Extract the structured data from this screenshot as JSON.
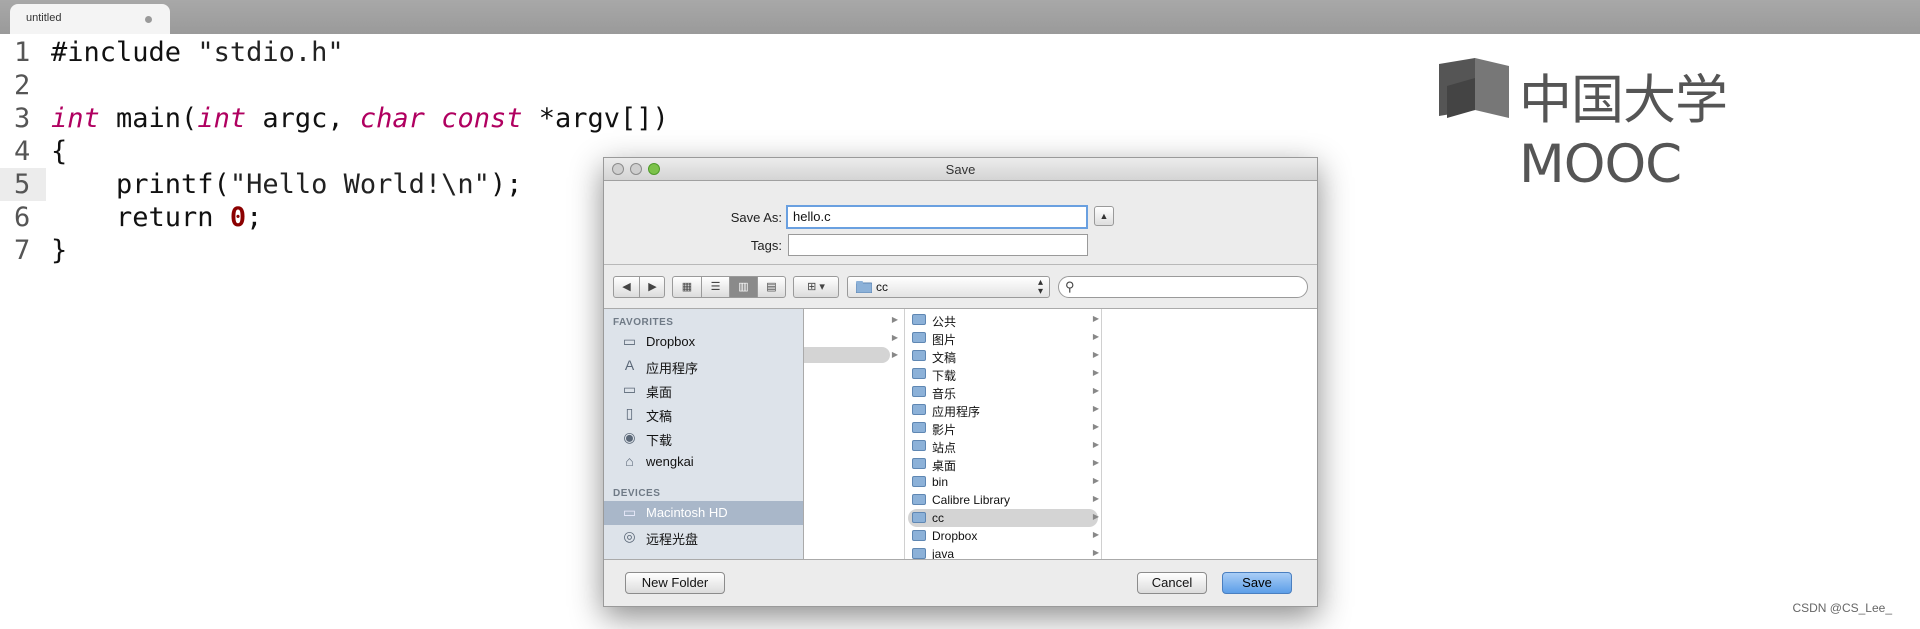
{
  "editor": {
    "tab_title": "untitled",
    "lines": [
      {
        "num": "1"
      },
      {
        "num": "2"
      },
      {
        "num": "3"
      },
      {
        "num": "4"
      },
      {
        "num": "5"
      },
      {
        "num": "6"
      },
      {
        "num": "7"
      }
    ],
    "code": {
      "l1_directive": "#include ",
      "l1_header": "\"stdio.h\"",
      "l3_int1": "int",
      "l3_main": " main(",
      "l3_int2": "int",
      "l3_argc": " argc, ",
      "l3_char": "char",
      "l3_sp": " ",
      "l3_const": "const",
      "l3_argv": " *argv[])",
      "l4": "{",
      "l5_printf": "    printf(",
      "l5_str": "\"Hello World!\\n\"",
      "l5_end": ");",
      "l6_return": "    return ",
      "l6_zero": "0",
      "l6_semi": ";",
      "l7": "}"
    }
  },
  "logo": {
    "text": "中国大学MOOC"
  },
  "dialog": {
    "title": "Save",
    "save_as_label": "Save As:",
    "save_as_value": "hello.c",
    "tags_label": "Tags:",
    "tags_value": "",
    "location": "cc",
    "sidebar": {
      "favorites_header": "FAVORITES",
      "favorites": [
        {
          "label": "Dropbox",
          "icon": "folder-icon"
        },
        {
          "label": "应用程序",
          "icon": "applications-icon"
        },
        {
          "label": "桌面",
          "icon": "desktop-icon"
        },
        {
          "label": "文稿",
          "icon": "documents-icon"
        },
        {
          "label": "下载",
          "icon": "downloads-icon"
        },
        {
          "label": "wengkai",
          "icon": "home-icon"
        }
      ],
      "devices_header": "DEVICES",
      "devices": [
        {
          "label": "Macintosh HD",
          "icon": "harddisk-icon"
        },
        {
          "label": "远程光盘",
          "icon": "remote-disc-icon"
        }
      ]
    },
    "column2": [
      {
        "label": "公共"
      },
      {
        "label": "图片"
      },
      {
        "label": "文稿"
      },
      {
        "label": "下载"
      },
      {
        "label": "音乐"
      },
      {
        "label": "应用程序"
      },
      {
        "label": "影片"
      },
      {
        "label": "站点"
      },
      {
        "label": "桌面"
      },
      {
        "label": "bin"
      },
      {
        "label": "Calibre Library"
      },
      {
        "label": "cc"
      },
      {
        "label": "Dropbox"
      },
      {
        "label": "java"
      }
    ],
    "new_folder_label": "New Folder",
    "cancel_label": "Cancel",
    "save_label": "Save"
  },
  "watermark": "CSDN @CS_Lee_"
}
